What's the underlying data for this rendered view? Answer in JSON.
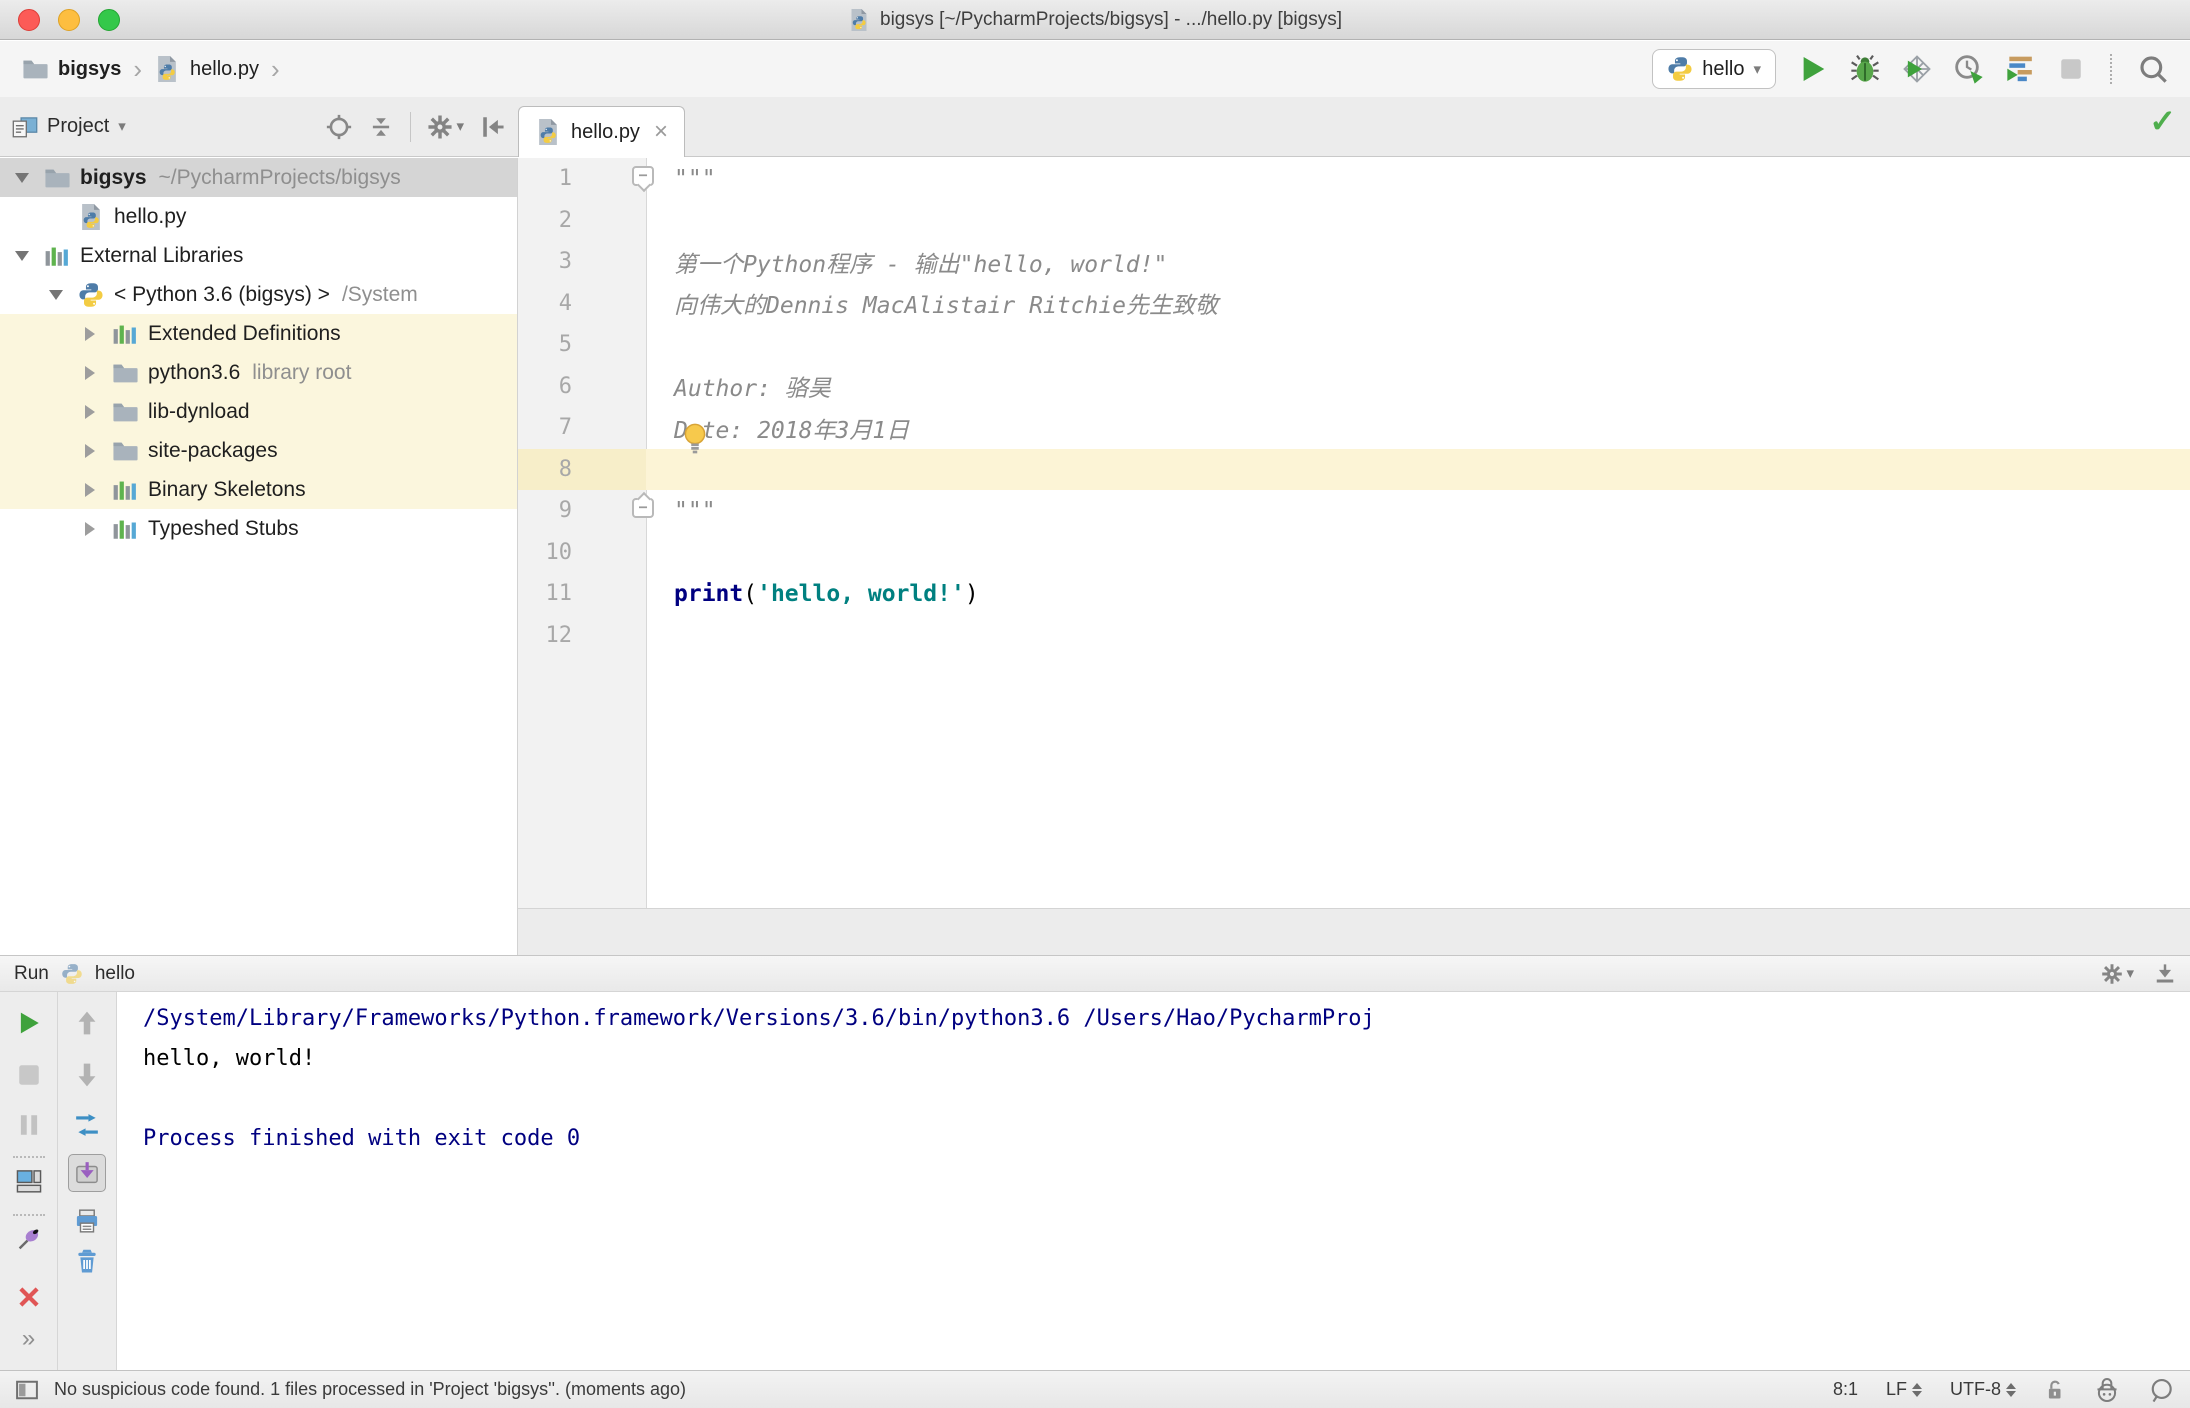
{
  "window": {
    "title": "bigsys [~/PycharmProjects/bigsys] - .../hello.py [bigsys]"
  },
  "navbar": {
    "breadcrumbs": [
      {
        "label": "bigsys",
        "icon": "folder"
      },
      {
        "label": "hello.py",
        "icon": "python-file"
      }
    ],
    "run_config": {
      "label": "hello",
      "icon": "python-logo"
    }
  },
  "project": {
    "header_title": "Project",
    "tree": [
      {
        "depth": 0,
        "arrow": "down",
        "icon": "folder",
        "label": "bigsys",
        "bold": true,
        "hint": "~/PycharmProjects/bigsys",
        "selected": true
      },
      {
        "depth": 1,
        "arrow": null,
        "icon": "python-file",
        "label": "hello.py"
      },
      {
        "depth": 0,
        "arrow": "down",
        "icon": "library",
        "label": "External Libraries"
      },
      {
        "depth": 1,
        "arrow": "down",
        "icon": "python-logo",
        "label": "< Python 3.6 (bigsys) >",
        "hint": "/System"
      },
      {
        "depth": 2,
        "arrow": "right",
        "icon": "library",
        "label": "Extended Definitions",
        "lib": true
      },
      {
        "depth": 2,
        "arrow": "right",
        "icon": "folder",
        "label": "python3.6",
        "hint": "library root",
        "lib": true
      },
      {
        "depth": 2,
        "arrow": "right",
        "icon": "folder",
        "label": "lib-dynload",
        "lib": true
      },
      {
        "depth": 2,
        "arrow": "right",
        "icon": "folder",
        "label": "site-packages",
        "lib": true
      },
      {
        "depth": 2,
        "arrow": "right",
        "icon": "library",
        "label": "Binary Skeletons",
        "lib": true
      },
      {
        "depth": 2,
        "arrow": "right",
        "icon": "library",
        "label": "Typeshed Stubs"
      }
    ]
  },
  "editor": {
    "tab": {
      "label": "hello.py"
    },
    "lines": [
      {
        "num": 1,
        "fold": "start",
        "segments": [
          {
            "t": "\"\"\"",
            "c": "doc"
          }
        ]
      },
      {
        "num": 2,
        "segments": []
      },
      {
        "num": 3,
        "segments": [
          {
            "t": "第一个Python程序 - 输出\"hello, world!\"",
            "c": "doc"
          }
        ]
      },
      {
        "num": 4,
        "segments": [
          {
            "t": "向伟大的Dennis MacAlistair Ritchie先生致敬",
            "c": "doc"
          }
        ]
      },
      {
        "num": 5,
        "segments": []
      },
      {
        "num": 6,
        "segments": [
          {
            "t": "Author: 骆昊",
            "c": "doc"
          }
        ]
      },
      {
        "num": 7,
        "bulb": true,
        "segments": [
          {
            "t": "Date: 2018年3月1日",
            "c": "doc"
          }
        ]
      },
      {
        "num": 8,
        "current": true,
        "segments": []
      },
      {
        "num": 9,
        "fold": "end",
        "segments": [
          {
            "t": "\"\"\"",
            "c": "doc"
          }
        ]
      },
      {
        "num": 10,
        "segments": []
      },
      {
        "num": 11,
        "segments": [
          {
            "t": "print",
            "c": "kw"
          },
          {
            "t": "(",
            "c": "pl"
          },
          {
            "t": "'hello, world!'",
            "c": "str"
          },
          {
            "t": ")",
            "c": "pl"
          }
        ]
      },
      {
        "num": 12,
        "segments": []
      }
    ]
  },
  "run": {
    "title": "Run",
    "config_label": "hello",
    "console": [
      {
        "t": "/System/Library/Frameworks/Python.framework/Versions/3.6/bin/python3.6 /Users/Hao/PycharmProj",
        "c": "sys"
      },
      {
        "t": "hello, world!",
        "c": "out"
      },
      {
        "t": "",
        "c": "out"
      },
      {
        "t": "Process finished with exit code 0",
        "c": "sys"
      }
    ]
  },
  "status": {
    "message": "No suspicious code found. 1 files processed in 'Project 'bigsys''. (moments ago)",
    "caret": "8:1",
    "line_sep": "LF",
    "encoding": "UTF-8"
  },
  "colors": {
    "run_green": "#3fa23c",
    "keyword": "#000080",
    "string": "#008080",
    "console_system": "#000080",
    "library_row": "#fbf6dd",
    "selected_row": "#d5d5d5",
    "current_line": "#fcf4d6"
  }
}
